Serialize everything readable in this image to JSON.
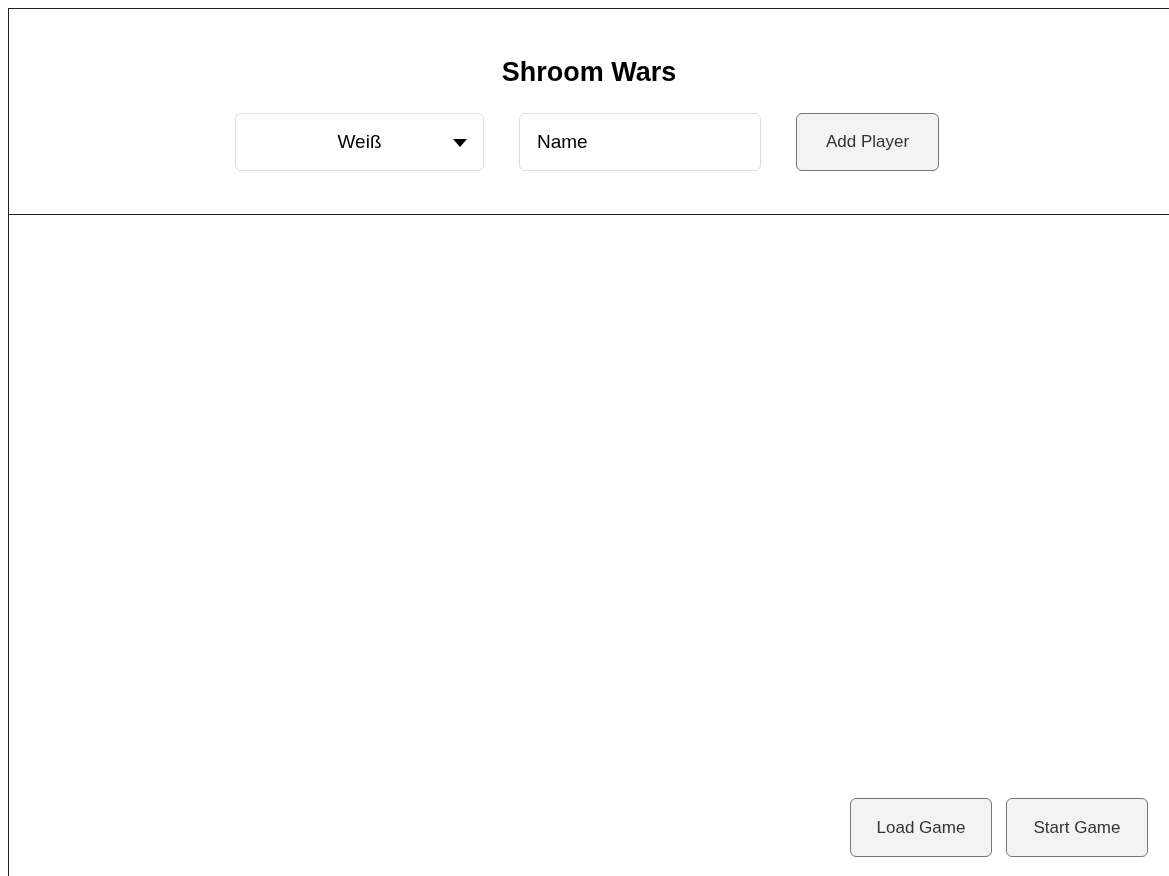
{
  "title": "Shroom Wars",
  "color_select": {
    "value": "Weiß"
  },
  "name_field": {
    "value": "Name"
  },
  "add_button": "Add Player",
  "footer_buttons": [
    "Load Game",
    "Start Game"
  ]
}
